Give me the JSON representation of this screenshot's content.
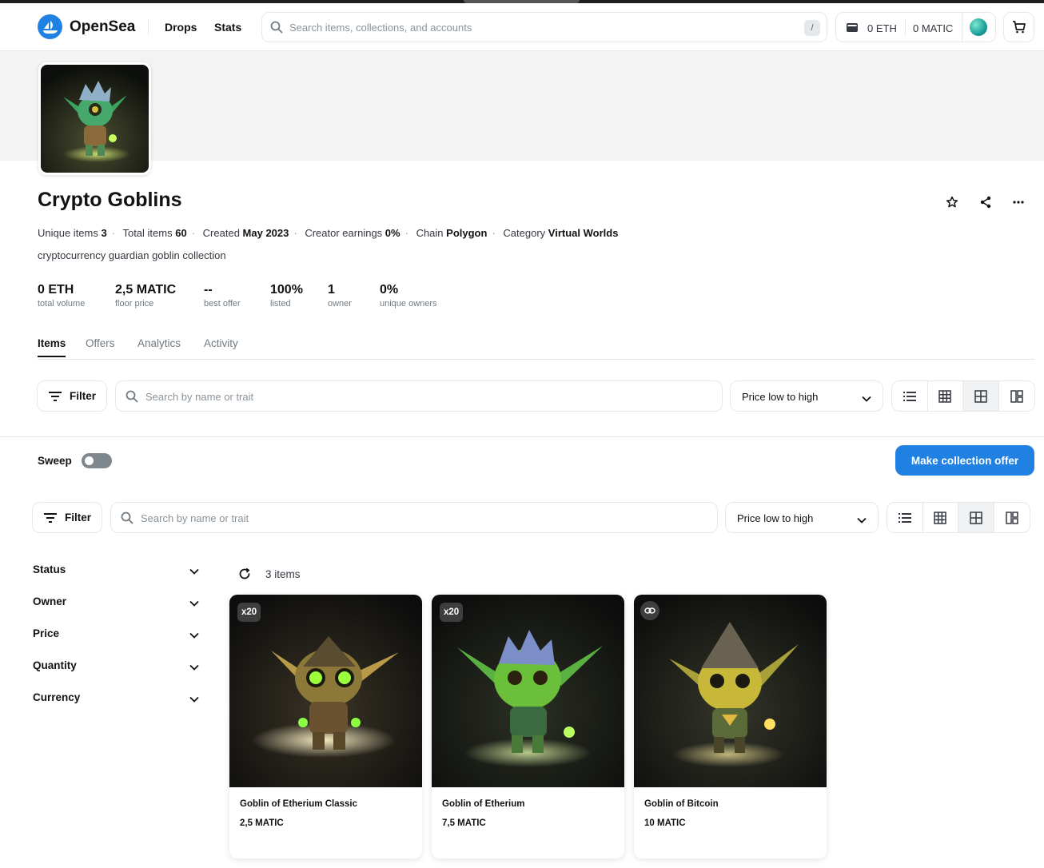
{
  "header": {
    "brand": "OpenSea",
    "nav": [
      "Drops",
      "Stats"
    ],
    "search_placeholder": "Search items, collections, and accounts",
    "search_shortcut": "/",
    "wallet_eth": "0 ETH",
    "wallet_matic": "0 MATIC"
  },
  "collection": {
    "title": "Crypto Goblins",
    "meta": [
      {
        "label": "Unique items",
        "value": "3"
      },
      {
        "label": "Total items",
        "value": "60"
      },
      {
        "label": "Created",
        "value": "May 2023"
      },
      {
        "label": "Creator earnings",
        "value": "0%"
      },
      {
        "label": "Chain",
        "value": "Polygon"
      },
      {
        "label": "Category",
        "value": "Virtual Worlds"
      }
    ],
    "description": "cryptocurrency guardian goblin collection",
    "stats": [
      {
        "value": "0 ETH",
        "label": "total volume"
      },
      {
        "value": "2,5 MATIC",
        "label": "floor price"
      },
      {
        "value": "--",
        "label": "best offer"
      },
      {
        "value": "100%",
        "label": "listed"
      },
      {
        "value": "1",
        "label": "owner"
      },
      {
        "value": "0%",
        "label": "unique owners"
      }
    ]
  },
  "tabs": [
    "Items",
    "Offers",
    "Analytics",
    "Activity"
  ],
  "toolbar": {
    "filter_label": "Filter",
    "search_placeholder": "Search by name or trait",
    "sort_value": "Price low to high"
  },
  "sweep_label": "Sweep",
  "offer_button": "Make collection offer",
  "filters": [
    "Status",
    "Owner",
    "Price",
    "Quantity",
    "Currency"
  ],
  "items_count": "3 items",
  "items": [
    {
      "name": "Goblin of Etherium Classic",
      "price": "2,5 MATIC",
      "badge": "x20",
      "hue": "gold"
    },
    {
      "name": "Goblin of Etherium",
      "price": "7,5 MATIC",
      "badge": "x20",
      "hue": "green"
    },
    {
      "name": "Goblin of Bitcoin",
      "price": "10 MATIC",
      "badge": "",
      "hue": "yellow"
    }
  ]
}
